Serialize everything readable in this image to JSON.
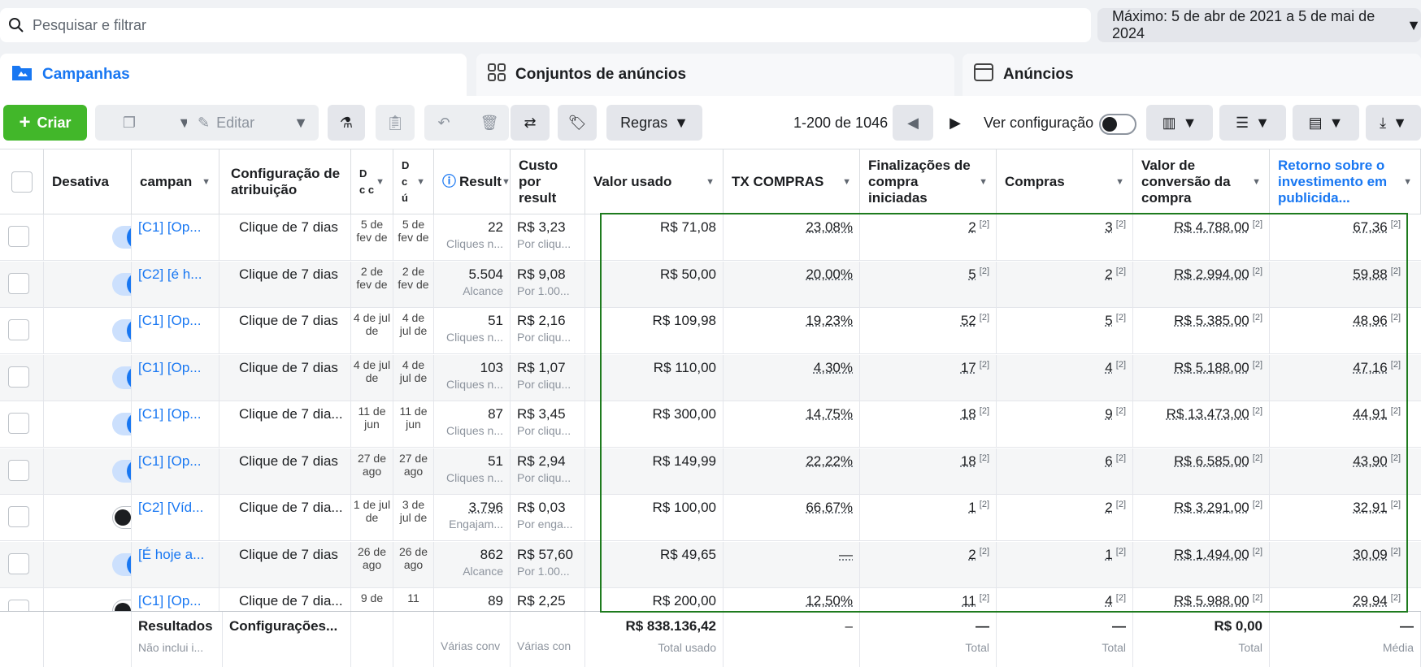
{
  "search": {
    "placeholder": "Pesquisar e filtrar"
  },
  "date_range": "Máximo: 5 de abr de 2021 a 5 de mai de 2024",
  "tabs": [
    {
      "label": "Campanhas",
      "icon": "folder-flag-icon",
      "active": true
    },
    {
      "label": "Conjuntos de anúncios",
      "icon": "grid-icon"
    },
    {
      "label": "Anúncios",
      "icon": "ad-window-icon"
    }
  ],
  "toolbar": {
    "create_label": "Criar",
    "edit_label": "Editar",
    "rules_label": "Regras",
    "pagination": "1-200 de 1046",
    "view_config_label": "Ver configuração"
  },
  "columns": {
    "deactivate": "Desativa",
    "campaign": "campan",
    "attribution": "Configuração de atribuição",
    "d1": "D c c",
    "d2": "D c ú",
    "results": "Result",
    "cost": "Custo por result",
    "spent": "Valor usado",
    "tx": "TX COMPRAS",
    "checkout": "Finalizações de compra iniciadas",
    "purchases": "Compras",
    "conv_value": "Valor de conversão da compra",
    "roas": "Retorno sobre o investimento em publicida..."
  },
  "rows": [
    {
      "on": true,
      "campaign": "[C1] [Op...",
      "attr": "Clique de 7 dias",
      "d1": "5 de fev de",
      "d2": "5 de fev de",
      "results": "22",
      "results_sub": "Cliques n...",
      "cost": "R$ 3,23",
      "cost_sub": "Por cliqu...",
      "spent": "R$ 71,08",
      "tx": "23,08%",
      "checkout": "2",
      "purchases": "3",
      "conv": "R$ 4.788,00",
      "roas": "67,36"
    },
    {
      "on": true,
      "campaign": "[C2] [é h...",
      "attr": "Clique de 7 dias",
      "d1": "2 de fev de",
      "d2": "2 de fev de",
      "results": "5.504",
      "results_sub": "Alcance",
      "cost": "R$ 9,08",
      "cost_sub": "Por 1.00...",
      "spent": "R$ 50,00",
      "tx": "20,00%",
      "checkout": "5",
      "purchases": "2",
      "conv": "R$ 2.994,00",
      "roas": "59,88"
    },
    {
      "on": true,
      "campaign": "[C1] [Op...",
      "attr": "Clique de 7 dias",
      "d1": "4 de jul de",
      "d2": "4 de jul de",
      "results": "51",
      "results_sub": "Cliques n...",
      "cost": "R$ 2,16",
      "cost_sub": "Por cliqu...",
      "spent": "R$ 109,98",
      "tx": "19,23%",
      "checkout": "52",
      "purchases": "5",
      "conv": "R$ 5.385,00",
      "roas": "48,96"
    },
    {
      "on": true,
      "campaign": "[C1] [Op...",
      "attr": "Clique de 7 dias",
      "d1": "4 de jul de",
      "d2": "4 de jul de",
      "results": "103",
      "results_sub": "Cliques n...",
      "cost": "R$ 1,07",
      "cost_sub": "Por cliqu...",
      "spent": "R$ 110,00",
      "tx": "4,30%",
      "checkout": "17",
      "purchases": "4",
      "conv": "R$ 5.188,00",
      "roas": "47,16"
    },
    {
      "on": true,
      "campaign": "[C1] [Op...",
      "attr": "Clique de 7 dia...",
      "d1": "11 de jun",
      "d2": "11 de jun",
      "results": "87",
      "results_sub": "Cliques n...",
      "cost": "R$ 3,45",
      "cost_sub": "Por cliqu...",
      "spent": "R$ 300,00",
      "tx": "14,75%",
      "checkout": "18",
      "purchases": "9",
      "conv": "R$ 13.473,00",
      "roas": "44,91"
    },
    {
      "on": true,
      "campaign": "[C1] [Op...",
      "attr": "Clique de 7 dias",
      "d1": "27 de ago",
      "d2": "27 de ago",
      "results": "51",
      "results_sub": "Cliques n...",
      "cost": "R$ 2,94",
      "cost_sub": "Por cliqu...",
      "spent": "R$ 149,99",
      "tx": "22,22%",
      "checkout": "18",
      "purchases": "6",
      "conv": "R$ 6.585,00",
      "roas": "43,90"
    },
    {
      "on": false,
      "campaign": "[C2] [Víd...",
      "attr": "Clique de 7 dia...",
      "d1": "1 de jul de",
      "d2": "3 de jul de",
      "results": "3.796",
      "results_sub": "Engajam...",
      "cost": "R$ 0,03",
      "cost_sub": "Por enga...",
      "spent": "R$ 100,00",
      "tx": "66,67%",
      "checkout": "1",
      "purchases": "2",
      "conv": "R$ 3.291,00",
      "roas": "32,91"
    },
    {
      "on": true,
      "campaign": "[É hoje a...",
      "attr": "Clique de 7 dias",
      "d1": "26 de ago",
      "d2": "26 de ago",
      "results": "862",
      "results_sub": "Alcance",
      "cost": "R$ 57,60",
      "cost_sub": "Por 1.00...",
      "spent": "R$ 49,65",
      "tx": "—",
      "checkout": "2",
      "purchases": "1",
      "conv": "R$ 1.494,00",
      "roas": "30,09"
    },
    {
      "on": false,
      "campaign": "[C1] [Op...",
      "attr": "Clique de 7 dia...",
      "d1": "9 de",
      "d2": "11",
      "results": "89",
      "results_sub": "",
      "cost": "R$ 2,25",
      "cost_sub": "",
      "spent": "R$ 200,00",
      "tx": "12,50%",
      "checkout": "11",
      "purchases": "4",
      "conv": "R$ 5.988,00",
      "roas": "29,94"
    }
  ],
  "footnote": "[2]",
  "footer": {
    "results_label": "Resultados",
    "results_sub": "Não inclui i...",
    "config_label": "Configurações...",
    "results_col_sub": "Várias conv",
    "cost_col_sub": "Várias con",
    "spent": "R$ 838.136,42",
    "spent_sub": "Total usado",
    "tx": "–",
    "checkout": "—",
    "checkout_sub": "Total",
    "purchases": "—",
    "purchases_sub": "Total",
    "conv": "R$ 0,00",
    "conv_sub": "Total",
    "roas": "—",
    "roas_sub": "Média"
  }
}
